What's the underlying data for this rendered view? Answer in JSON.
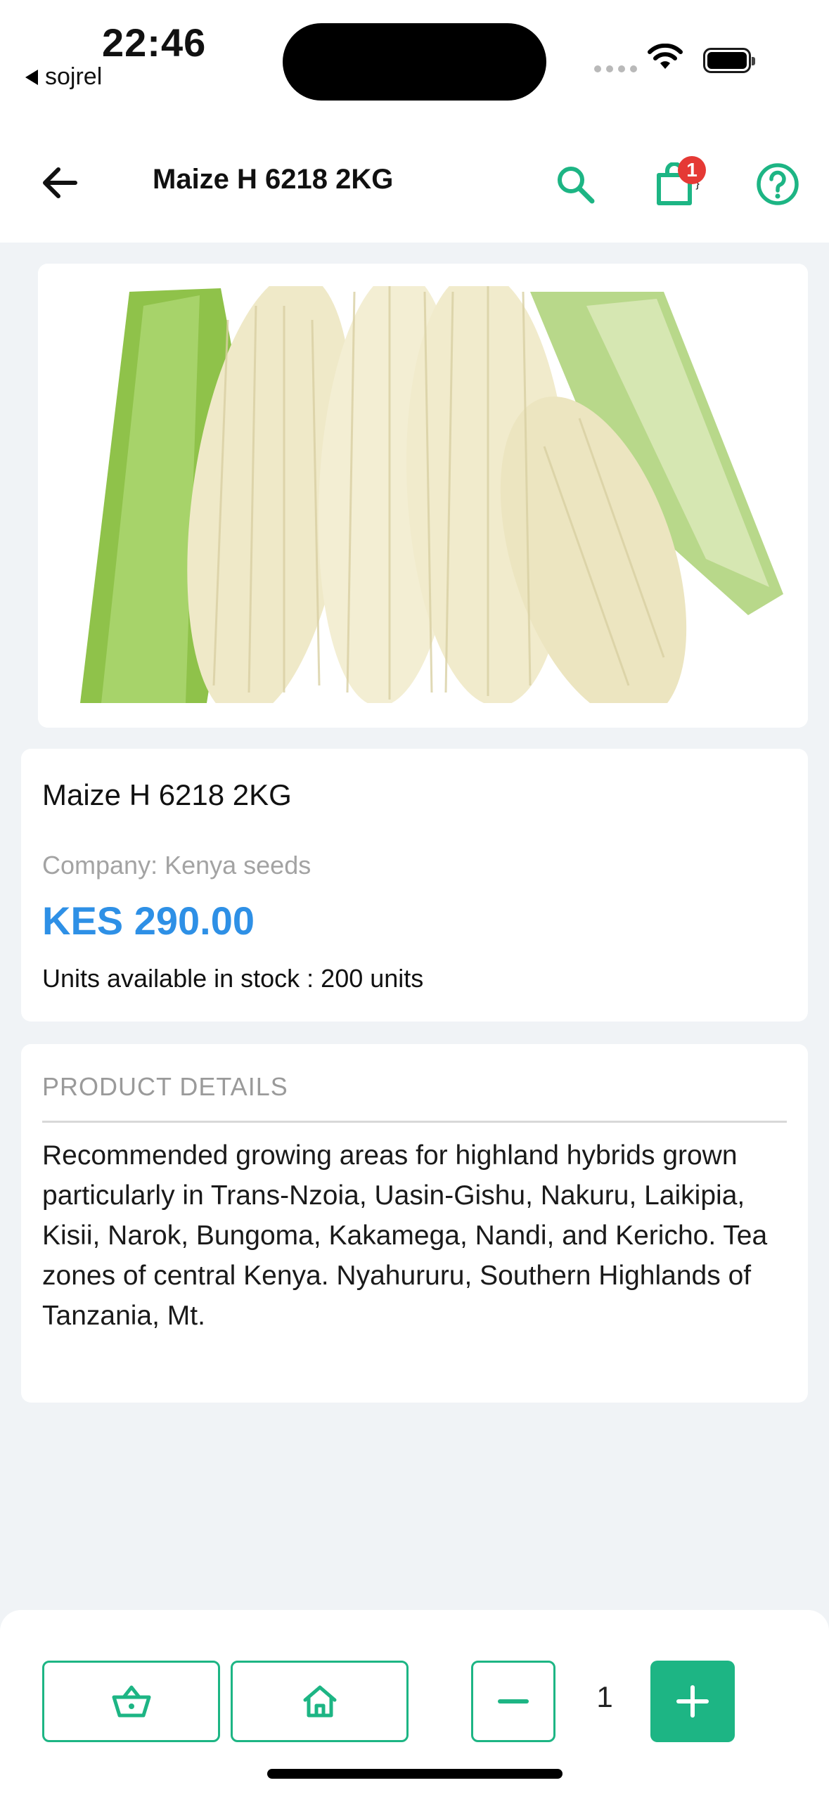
{
  "status_bar": {
    "time": "22:46",
    "back_app": "sojrel"
  },
  "app_bar": {
    "title": "Maize H 6218 2KG",
    "cart_count": "1",
    "icons": {
      "back": "arrow-left-icon",
      "search": "search-icon",
      "cart": "shopping-bag-icon",
      "help": "help-circle-icon"
    }
  },
  "product": {
    "image_alt": "maize-cobs-image",
    "name": "Maize H 6218 2KG",
    "company": "Company: Kenya seeds",
    "price": "KES 290.00",
    "stock": "Units available in stock : 200 units"
  },
  "details": {
    "heading": "PRODUCT DETAILS",
    "text": "Recommended growing areas for highland hybrids grown particularly in Trans-Nzoia, Uasin-Gishu, Nakuru, Laikipia, Kisii, Narok, Bungoma, Kakamega, Nandi, and Kericho. Tea zones of central Kenya. Nyahururu, Southern Highlands of Tanzania, Mt."
  },
  "bottom_bar": {
    "quantity": "1",
    "icons": {
      "basket": "basket-icon",
      "home": "home-icon",
      "minus": "minus-icon",
      "plus": "plus-icon"
    }
  },
  "colors": {
    "accent": "#1db584",
    "price": "#2e90e6",
    "badge": "#e53935",
    "background": "#f0f3f6"
  }
}
